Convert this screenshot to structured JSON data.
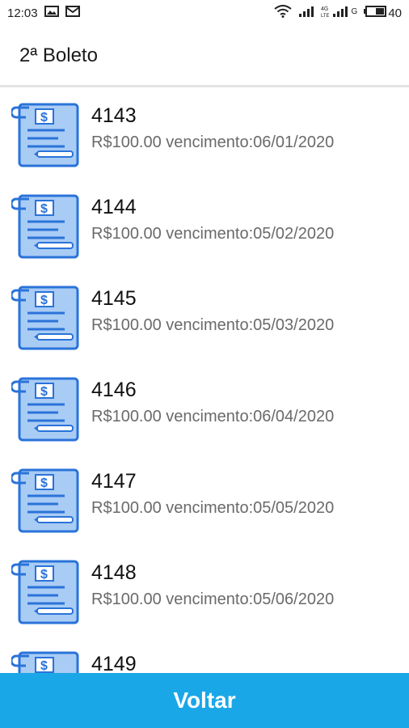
{
  "status_bar": {
    "time": "12:03",
    "network_label": "G",
    "battery": "40",
    "icons": [
      "image-icon",
      "mail-icon",
      "wifi-icon",
      "signal-icon",
      "signal-4g-icon",
      "battery-icon"
    ]
  },
  "header": {
    "title": "2ª Boleto"
  },
  "boletos": [
    {
      "number": "4143",
      "subtitle": "R$100.00 vencimento:06/01/2020"
    },
    {
      "number": "4144",
      "subtitle": "R$100.00 vencimento:05/02/2020"
    },
    {
      "number": "4145",
      "subtitle": "R$100.00 vencimento:05/03/2020"
    },
    {
      "number": "4146",
      "subtitle": "R$100.00 vencimento:06/04/2020"
    },
    {
      "number": "4147",
      "subtitle": "R$100.00 vencimento:05/05/2020"
    },
    {
      "number": "4148",
      "subtitle": "R$100.00 vencimento:05/06/2020"
    },
    {
      "number": "4149",
      "subtitle": ""
    }
  ],
  "footer": {
    "button_label": "Voltar"
  },
  "colors": {
    "accent": "#1aa7e8",
    "icon_fill": "#a9ccf5",
    "icon_stroke": "#2a73d9"
  }
}
